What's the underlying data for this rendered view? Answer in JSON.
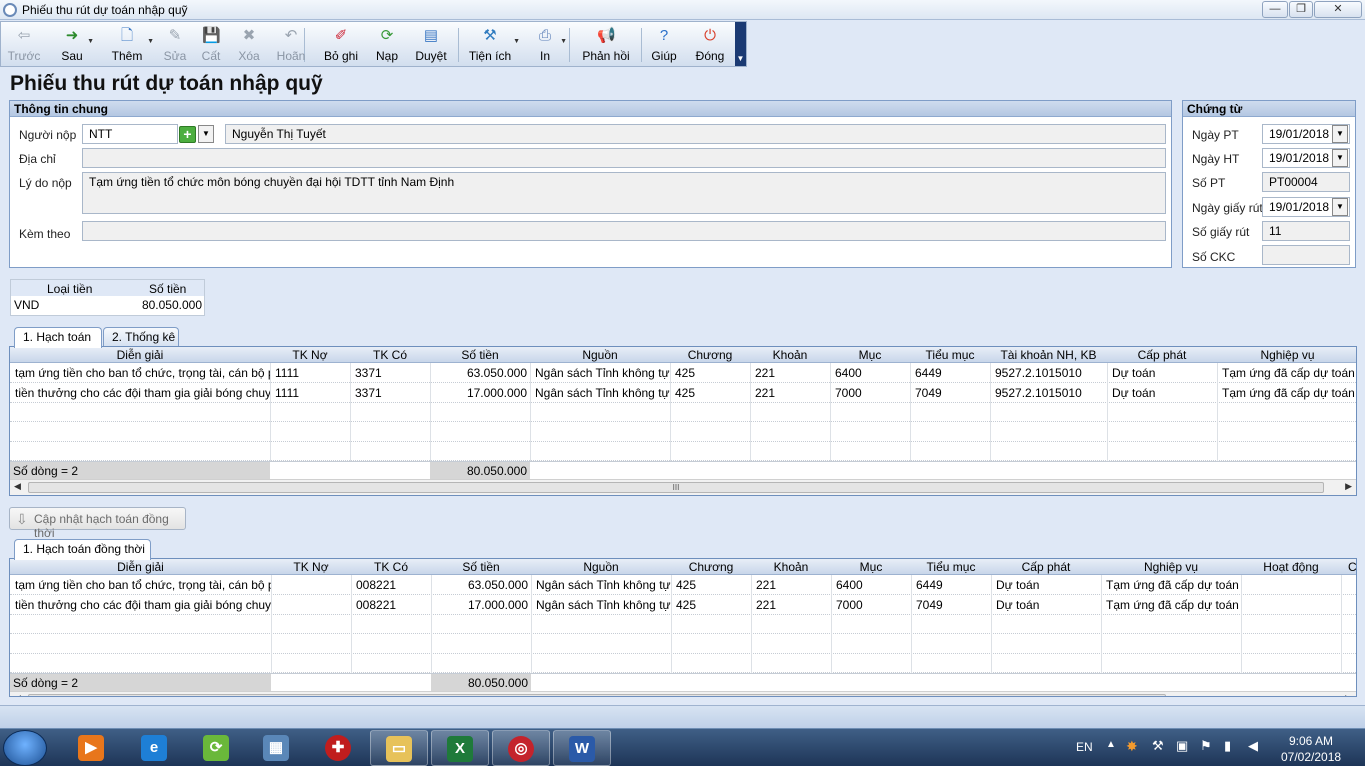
{
  "window": {
    "title": "Phiếu thu rút dự toán nhập quỹ",
    "minimize": "—",
    "restore": "❐",
    "close": "✕"
  },
  "toolbar": {
    "items": [
      {
        "label": "Trước",
        "icon": "arrow-left-icon",
        "glyph": "⇦",
        "enabled": false
      },
      {
        "label": "Sau",
        "icon": "arrow-right-icon",
        "glyph": "➜",
        "enabled": true,
        "dropdown": true
      },
      {
        "label": "Thêm",
        "icon": "add-document-icon",
        "glyph": "🗋",
        "enabled": true,
        "dropdown": true
      },
      {
        "label": "Sửa",
        "icon": "edit-icon",
        "glyph": "✎",
        "enabled": false
      },
      {
        "label": "Cất",
        "icon": "save-icon",
        "glyph": "💾",
        "enabled": false
      },
      {
        "label": "Xóa",
        "icon": "delete-icon",
        "glyph": "✖",
        "enabled": false
      },
      {
        "label": "Hoãn",
        "icon": "undo-icon",
        "glyph": "↶",
        "enabled": false
      },
      {
        "label": "Bỏ ghi",
        "icon": "unpost-icon",
        "glyph": "✐",
        "enabled": true
      },
      {
        "label": "Nạp",
        "icon": "reload-icon",
        "glyph": "⟳",
        "enabled": true
      },
      {
        "label": "Duyệt",
        "icon": "browse-icon",
        "glyph": "▤",
        "enabled": true
      },
      {
        "label": "Tiện ích",
        "icon": "tools-icon",
        "glyph": "⚒",
        "enabled": true,
        "dropdown": true
      },
      {
        "label": "In",
        "icon": "print-icon",
        "glyph": "⎙",
        "enabled": true,
        "dropdown": true
      },
      {
        "label": "Phản hồi",
        "icon": "megaphone-icon",
        "glyph": "📢",
        "enabled": true
      },
      {
        "label": "Giúp",
        "icon": "help-icon",
        "glyph": "?",
        "enabled": true
      },
      {
        "label": "Đóng",
        "icon": "power-icon",
        "glyph": "⏻",
        "enabled": true
      }
    ]
  },
  "heading": "Phiếu thu rút dự toán nhập quỹ",
  "general": {
    "title": "Thông tin chung",
    "payer_label": "Người nộp",
    "payer_code": "NTT",
    "payer_name": "Nguyễn Thị Tuyết",
    "address_label": "Địa chỉ",
    "address": "",
    "reason_label": "Lý do nộp",
    "reason": "Tạm ứng tiền tổ chức môn bóng chuyền đại hội TDTT tỉnh Nam Định",
    "attach_label": "Kèm theo",
    "attach": ""
  },
  "voucher": {
    "title": "Chứng từ",
    "ngay_pt_label": "Ngày PT",
    "ngay_pt": "19/01/2018",
    "ngay_ht_label": "Ngày HT",
    "ngay_ht": "19/01/2018",
    "so_pt_label": "Số PT",
    "so_pt": "PT00004",
    "ngay_giay_rut_label": "Ngày giấy rút",
    "ngay_giay_rut": "19/01/2018",
    "so_giay_rut_label": "Số giấy rút",
    "so_giay_rut": "11",
    "so_ckc_label": "Số CKC",
    "so_ckc": ""
  },
  "currency": {
    "col_type": "Loại tiền",
    "col_amount": "Số tiền",
    "type": "VND",
    "amount": "80.050.000"
  },
  "tabs1": [
    {
      "label": "1. Hạch toán"
    },
    {
      "label": "2. Thống kê"
    }
  ],
  "grid1": {
    "headers": [
      "Diễn giải",
      "TK Nợ",
      "TK Có",
      "Số tiền",
      "Nguồn",
      "Chương",
      "Khoản",
      "Mục",
      "Tiểu mục",
      "Tài khoản NH, KB",
      "Cấp phát",
      "Nghiệp vụ"
    ],
    "rows": [
      [
        "tạm ứng tiền cho ban tổ chức, trọng tài, cán bộ p...",
        "1111",
        "3371",
        "63.050.000",
        "Ngân sách Tỉnh không tự...",
        "425",
        "221",
        "6400",
        "6449",
        "9527.2.1015010",
        "Dự toán",
        "Tạm ứng đã cấp dự toán"
      ],
      [
        "tiền thưởng cho các đội tham gia giải bóng chuyền",
        "1111",
        "3371",
        "17.000.000",
        "Ngân sách Tỉnh không tự...",
        "425",
        "221",
        "7000",
        "7049",
        "9527.2.1015010",
        "Dự toán",
        "Tạm ứng đã cấp dự toán"
      ]
    ],
    "footer_count": "Số dòng = 2",
    "footer_total": "80.050.000"
  },
  "update_button": "Cập nhật hạch toán đồng thời",
  "tabs2": [
    {
      "label": "1. Hạch toán đồng thời"
    }
  ],
  "grid2": {
    "headers": [
      "Diễn giải",
      "TK Nợ",
      "TK Có",
      "Số tiền",
      "Nguồn",
      "Chương",
      "Khoản",
      "Mục",
      "Tiểu mục",
      "Cấp phát",
      "Nghiệp vụ",
      "Hoạt động",
      "CT"
    ],
    "rows": [
      [
        "tạm ứng tiền cho ban tổ chức, trọng tài, cán bộ p...",
        "",
        "008221",
        "63.050.000",
        "Ngân sách Tỉnh không tự...",
        "425",
        "221",
        "6400",
        "6449",
        "Dự toán",
        "Tạm ứng đã cấp dự toán",
        "",
        ""
      ],
      [
        "tiền thưởng cho các đội tham gia giải bóng chuyền",
        "",
        "008221",
        "17.000.000",
        "Ngân sách Tỉnh không tự...",
        "425",
        "221",
        "7000",
        "7049",
        "Dự toán",
        "Tạm ứng đã cấp dự toán",
        "",
        ""
      ]
    ],
    "footer_count": "Số dòng = 2",
    "footer_total": "80.050.000"
  },
  "taskbar": {
    "lang": "EN",
    "time": "9:06 AM",
    "date": "07/02/2018"
  }
}
